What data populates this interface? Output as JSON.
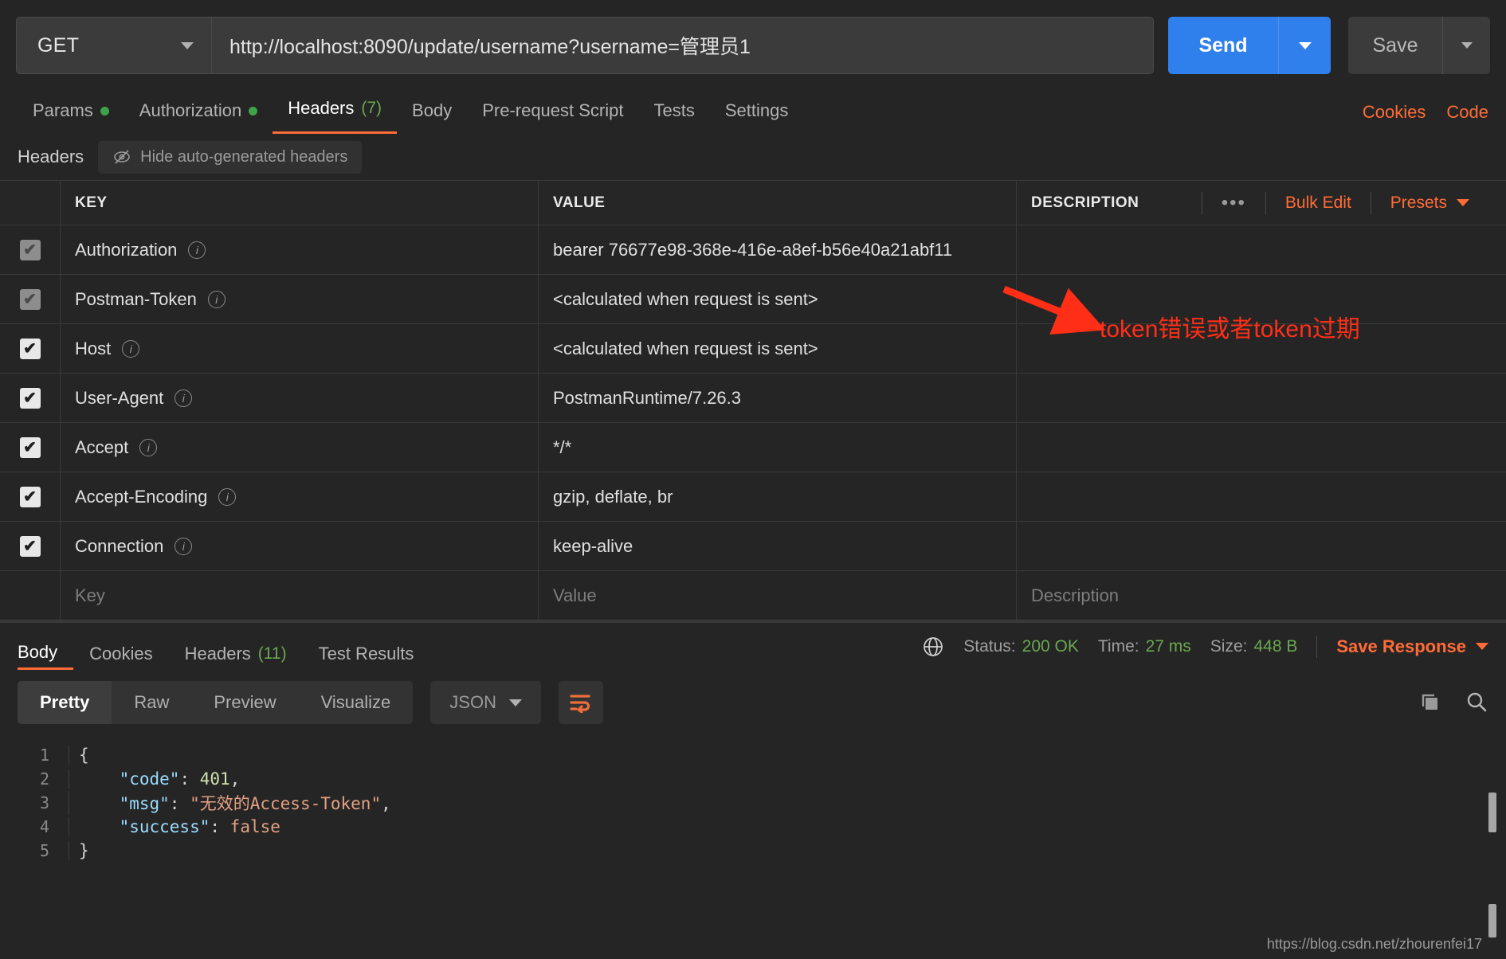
{
  "request": {
    "method": "GET",
    "url": "http://localhost:8090/update/username?username=管理员1",
    "send_label": "Send",
    "save_label": "Save"
  },
  "request_tabs": [
    {
      "label": "Params",
      "dot": true,
      "count": "",
      "active": false
    },
    {
      "label": "Authorization",
      "dot": true,
      "count": "",
      "active": false
    },
    {
      "label": "Headers",
      "dot": false,
      "count": "(7)",
      "active": true
    },
    {
      "label": "Body",
      "dot": false,
      "count": "",
      "active": false
    },
    {
      "label": "Pre-request Script",
      "dot": false,
      "count": "",
      "active": false
    },
    {
      "label": "Tests",
      "dot": false,
      "count": "",
      "active": false
    },
    {
      "label": "Settings",
      "dot": false,
      "count": "",
      "active": false
    }
  ],
  "request_tabs_right": {
    "cookies": "Cookies",
    "code": "Code"
  },
  "headers_subbar": {
    "title": "Headers",
    "hide_label": "Hide auto-generated headers",
    "eye_icon": "eye-off-icon"
  },
  "headers_table": {
    "columns": {
      "key": "KEY",
      "value": "VALUE",
      "description": "DESCRIPTION"
    },
    "actions": {
      "more": "•••",
      "bulk_edit": "Bulk Edit",
      "presets": "Presets"
    },
    "rows": [
      {
        "checked": true,
        "dim": true,
        "key": "Authorization",
        "value": "bearer 76677e98-368e-416e-a8ef-b56e40a21abf11",
        "description": ""
      },
      {
        "checked": true,
        "dim": true,
        "key": "Postman-Token",
        "value": "<calculated when request is sent>",
        "description": ""
      },
      {
        "checked": true,
        "dim": false,
        "key": "Host",
        "value": "<calculated when request is sent>",
        "description": ""
      },
      {
        "checked": true,
        "dim": false,
        "key": "User-Agent",
        "value": "PostmanRuntime/7.26.3",
        "description": ""
      },
      {
        "checked": true,
        "dim": false,
        "key": "Accept",
        "value": "*/*",
        "description": ""
      },
      {
        "checked": true,
        "dim": false,
        "key": "Accept-Encoding",
        "value": "gzip, deflate, br",
        "description": ""
      },
      {
        "checked": true,
        "dim": false,
        "key": "Connection",
        "value": "keep-alive",
        "description": ""
      }
    ],
    "placeholder_row": {
      "key": "Key",
      "value": "Value",
      "description": "Description"
    }
  },
  "annotation": {
    "text": "token错误或者token过期",
    "color": "#ff2e17"
  },
  "response_tabs": [
    {
      "label": "Body",
      "count": "",
      "active": true
    },
    {
      "label": "Cookies",
      "count": "",
      "active": false
    },
    {
      "label": "Headers",
      "count": "(11)",
      "active": false
    },
    {
      "label": "Test Results",
      "count": "",
      "active": false
    }
  ],
  "response_meta": {
    "globe_icon": "globe-icon",
    "status_label": "Status:",
    "status_value": "200 OK",
    "time_label": "Time:",
    "time_value": "27 ms",
    "size_label": "Size:",
    "size_value": "448 B",
    "save_response": "Save Response"
  },
  "body_toolbar": {
    "views": [
      {
        "label": "Pretty",
        "active": true
      },
      {
        "label": "Raw",
        "active": false
      },
      {
        "label": "Preview",
        "active": false
      },
      {
        "label": "Visualize",
        "active": false
      }
    ],
    "format": "JSON",
    "wrap_icon": "wrap-lines-icon",
    "copy_icon": "copy-icon",
    "search_icon": "search-icon"
  },
  "response_body": {
    "language": "json",
    "lines": [
      {
        "no": "1",
        "tokens": [
          {
            "t": "{",
            "c": "k-pun"
          }
        ]
      },
      {
        "no": "2",
        "tokens": [
          {
            "t": "    ",
            "c": "k-pun"
          },
          {
            "t": "\"code\"",
            "c": "k-key"
          },
          {
            "t": ": ",
            "c": "k-pun"
          },
          {
            "t": "401",
            "c": "k-num"
          },
          {
            "t": ",",
            "c": "k-pun"
          }
        ]
      },
      {
        "no": "3",
        "tokens": [
          {
            "t": "    ",
            "c": "k-pun"
          },
          {
            "t": "\"msg\"",
            "c": "k-key"
          },
          {
            "t": ": ",
            "c": "k-pun"
          },
          {
            "t": "\"无效的Access-Token\"",
            "c": "k-str"
          },
          {
            "t": ",",
            "c": "k-pun"
          }
        ]
      },
      {
        "no": "4",
        "tokens": [
          {
            "t": "    ",
            "c": "k-pun"
          },
          {
            "t": "\"success\"",
            "c": "k-key"
          },
          {
            "t": ": ",
            "c": "k-pun"
          },
          {
            "t": "false",
            "c": "k-bool"
          }
        ]
      },
      {
        "no": "5",
        "tokens": [
          {
            "t": "}",
            "c": "k-pun"
          }
        ]
      }
    ]
  },
  "watermark": "https://blog.csdn.net/zhourenfei17",
  "colors": {
    "accent": "#ff6c37",
    "send": "#2f80ed",
    "green": "#6aa84f",
    "annotation": "#ff2e17"
  }
}
